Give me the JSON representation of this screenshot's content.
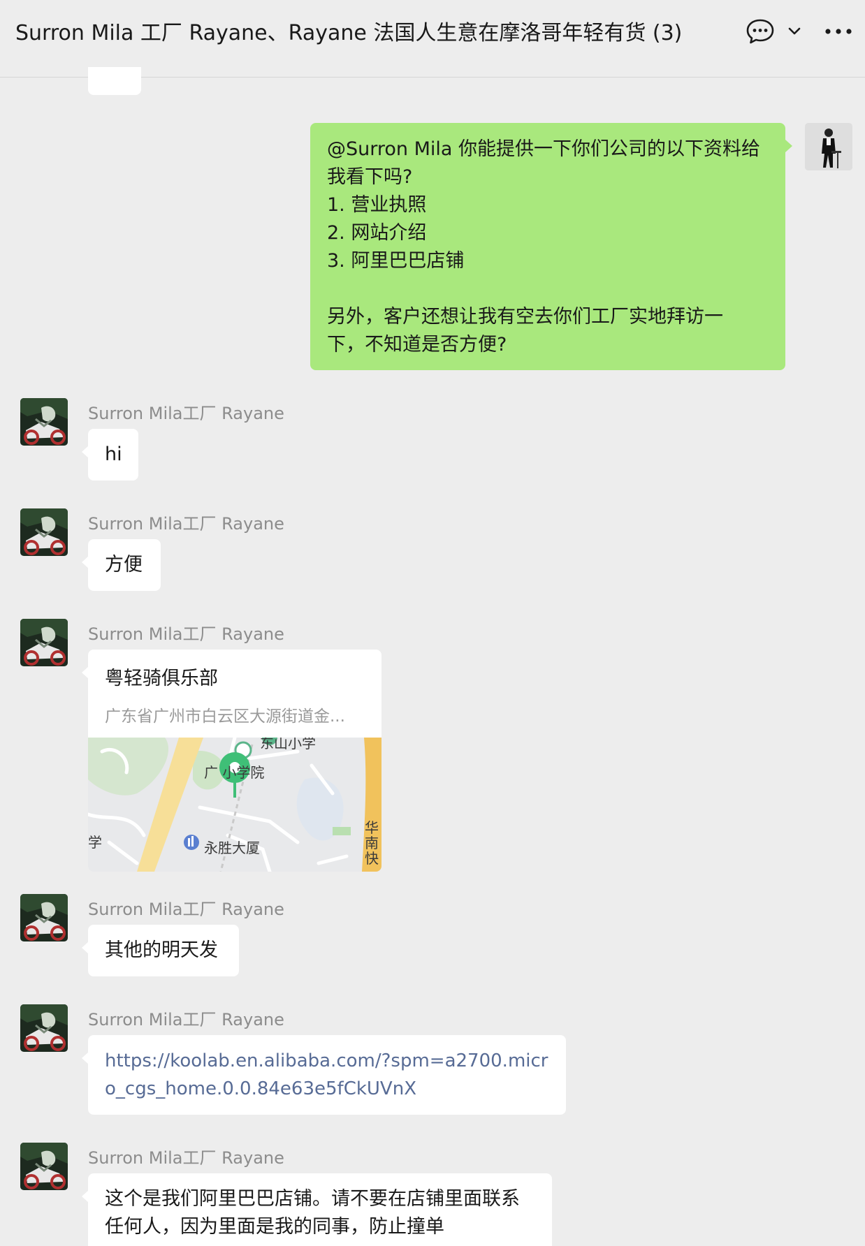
{
  "header": {
    "title": "Surron Mila 工厂 Rayane、Rayane 法国人生意在摩洛哥年轻有货 (3)",
    "chat_icon": "chat-bubble-icon",
    "chevron_icon": "chevron-down-icon",
    "more_icon": "more-dots-icon"
  },
  "sender_name": "Surron Mila工厂 Rayane",
  "messages": {
    "m1": {
      "lines": [
        "@Surron Mila 你能提供一下你们公司的以下资料给",
        "我看下吗?",
        "1. 营业执照",
        "2. 网站介绍",
        "3. 阿里巴巴店铺",
        "",
        "另外，客户还想让我有空去你们工厂实地拜访一",
        "下，不知道是否方便?"
      ]
    },
    "m2": {
      "text": "hi"
    },
    "m3": {
      "text": "方便"
    },
    "m4": {
      "title": "粤轻骑俱乐部",
      "address": "广东省广州市白云区大源街道金...",
      "map_labels": {
        "school": "广 小学院",
        "school_top": "东山小学",
        "building": "永胜大厦",
        "road": "华南快",
        "left": "学"
      }
    },
    "m5": {
      "text": "其他的明天发"
    },
    "m6": {
      "lines": [
        "https://koolab.en.alibaba.com/?spm=a2700.micr",
        "o_cgs_home.0.0.84e63e5fCkUVnX"
      ]
    },
    "m7": {
      "lines": [
        "这个是我们阿里巴巴店铺。请不要在店铺里面联系",
        "任何人，因为里面是我的同事，防止撞单"
      ]
    }
  },
  "colors": {
    "background": "#ededed",
    "outgoing_bubble": "#a9e87d",
    "incoming_bubble": "#ffffff",
    "link": "#576b95",
    "sender": "#8c8c8c"
  }
}
